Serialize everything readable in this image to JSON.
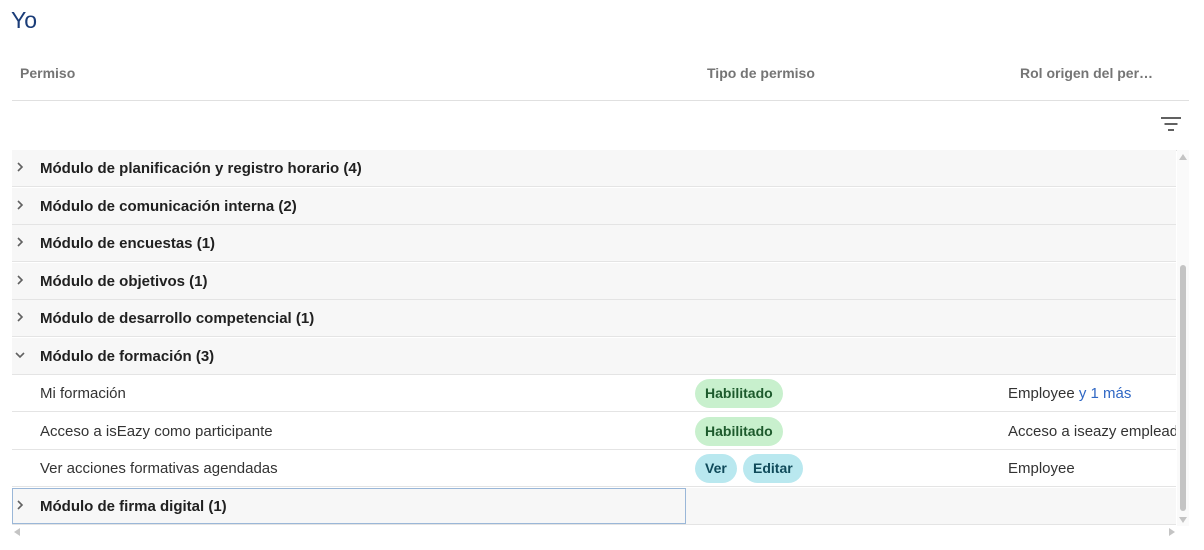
{
  "page": {
    "title": "Yo"
  },
  "columns": {
    "permiso": "Permiso",
    "tipo": "Tipo de permiso",
    "rol": "Rol origen del per…"
  },
  "colors": {
    "title": "#1a3c78",
    "habilitado_bg": "#c8f0cd",
    "action_bg": "#b9e8ef",
    "link": "#2f67c4"
  },
  "filter": {
    "icon": "filter-lines-icon"
  },
  "groups": [
    {
      "label": "Módulo de planificación y registro horario",
      "count": "(4)",
      "expanded": false
    },
    {
      "label": "Módulo de comunicación interna",
      "count": "(2)",
      "expanded": false
    },
    {
      "label": "Módulo de encuestas",
      "count": "(1)",
      "expanded": false
    },
    {
      "label": "Módulo de objetivos",
      "count": "(1)",
      "expanded": false
    },
    {
      "label": "Módulo de desarrollo competencial",
      "count": "(1)",
      "expanded": false
    },
    {
      "label": "Módulo de formación",
      "count": "(3)",
      "expanded": true
    },
    {
      "label": "Módulo de firma digital",
      "count": "(1)",
      "expanded": false
    }
  ],
  "formacion_rows": [
    {
      "permiso": "Mi formación",
      "badges": [
        "Habilitado"
      ],
      "rol": "Employee",
      "rol_more": "y 1 más"
    },
    {
      "permiso": "Acceso a isEazy como participante",
      "badges": [
        "Habilitado"
      ],
      "rol": "Acceso a iseazy empleado",
      "rol_more": ""
    },
    {
      "permiso": "Ver acciones formativas agendadas",
      "badges": [
        "Ver",
        "Editar"
      ],
      "rol": "Employee",
      "rol_more": ""
    }
  ]
}
